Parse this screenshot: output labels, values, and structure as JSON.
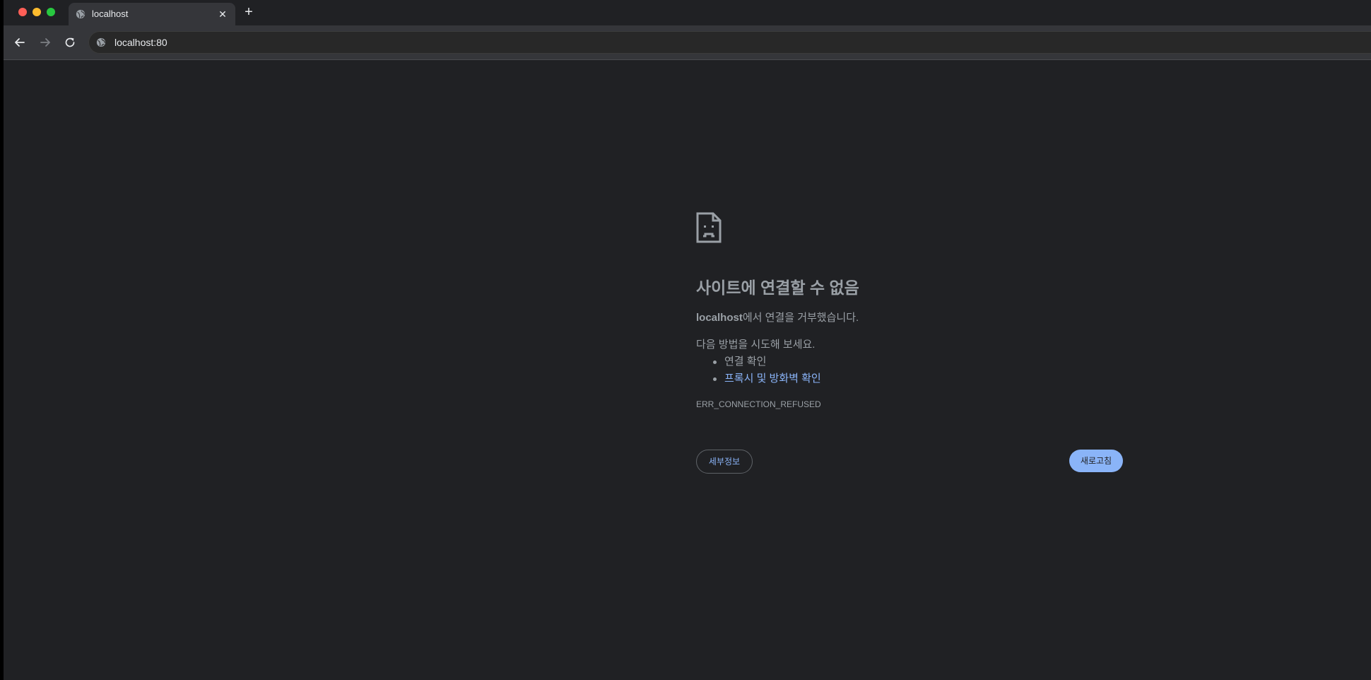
{
  "browser": {
    "tab": {
      "title": "localhost",
      "close_glyph": "✕",
      "icon": "globe-icon"
    },
    "new_tab_glyph": "+",
    "address_bar": {
      "url": "localhost:80",
      "icon": "site-info-icon"
    },
    "colors": {
      "chrome": "#35363a",
      "tabstrip": "#202124",
      "accent": "#8ab4f8"
    }
  },
  "error_page": {
    "icon": "sad-page-icon",
    "title": "사이트에 연결할 수 없음",
    "summary_host": "localhost",
    "summary_text": "에서 연결을 거부했습니다.",
    "try_heading": "다음 방법을 시도해 보세요.",
    "suggestions": [
      {
        "label": "연결 확인",
        "link": false
      },
      {
        "label": "프록시 및 방화벽 확인",
        "link": true
      }
    ],
    "error_code": "ERR_CONNECTION_REFUSED",
    "details_button": "세부정보",
    "reload_button": "새로고침"
  }
}
